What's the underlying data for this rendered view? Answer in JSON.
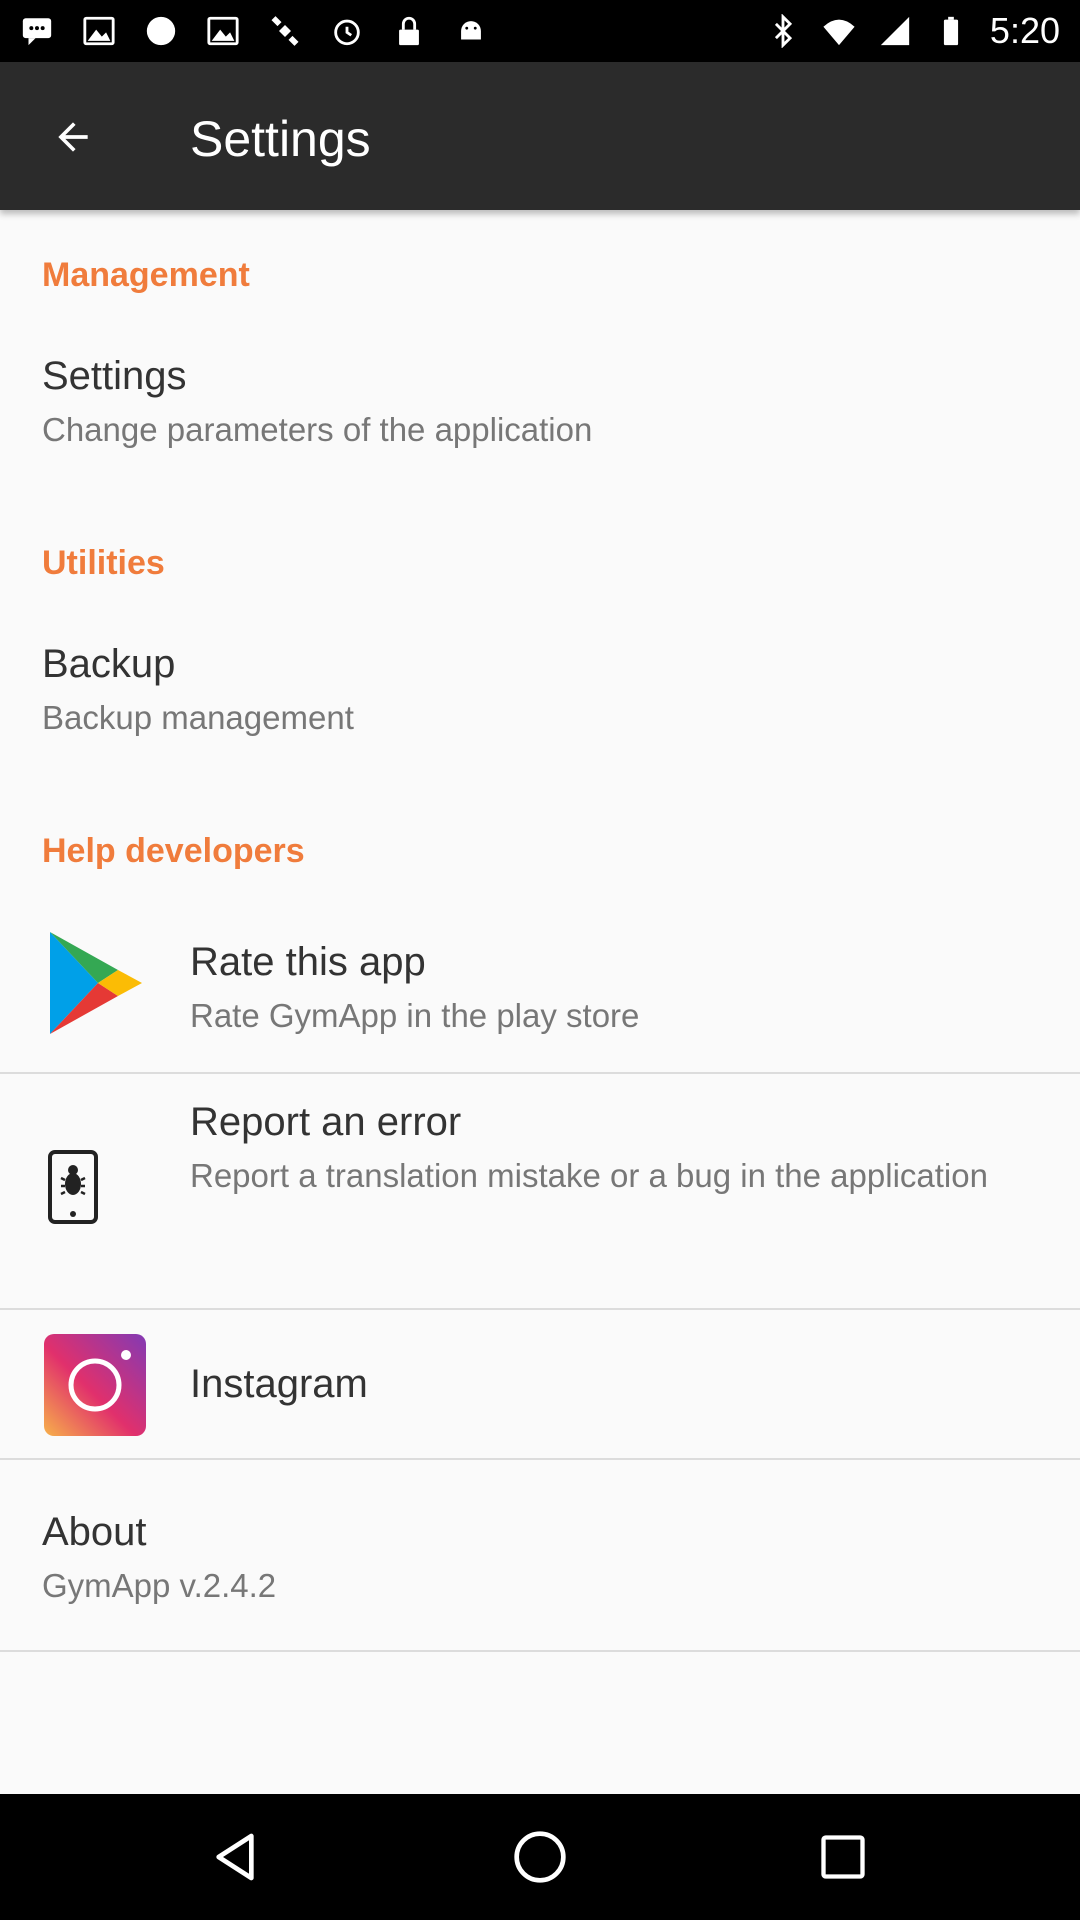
{
  "status_bar": {
    "time": "5:20",
    "left_icons": [
      "chat-icon",
      "photo-icon",
      "circle-icon",
      "photo-icon",
      "satellite-icon",
      "alarm-icon",
      "lock-icon",
      "android-icon"
    ],
    "right_icons": [
      "bluetooth-icon",
      "wifi-icon",
      "signal-icon",
      "battery-icon"
    ]
  },
  "toolbar": {
    "title": "Settings"
  },
  "sections": {
    "management": {
      "header": "Management",
      "settings_title": "Settings",
      "settings_sub": "Change parameters of the application"
    },
    "utilities": {
      "header": "Utilities",
      "backup_title": "Backup",
      "backup_sub": "Backup management"
    },
    "help": {
      "header": "Help developers",
      "rate_title": "Rate this app",
      "rate_sub": "Rate GymApp in the play store",
      "report_title": "Report an error",
      "report_sub": "Report a translation mistake or a bug in the application",
      "instagram_title": "Instagram"
    },
    "about": {
      "title": "About",
      "version": "GymApp v.2.4.2"
    }
  },
  "colors": {
    "accent": "#f07c3c",
    "toolbar": "#2b2b2b",
    "background": "#fafafa"
  }
}
